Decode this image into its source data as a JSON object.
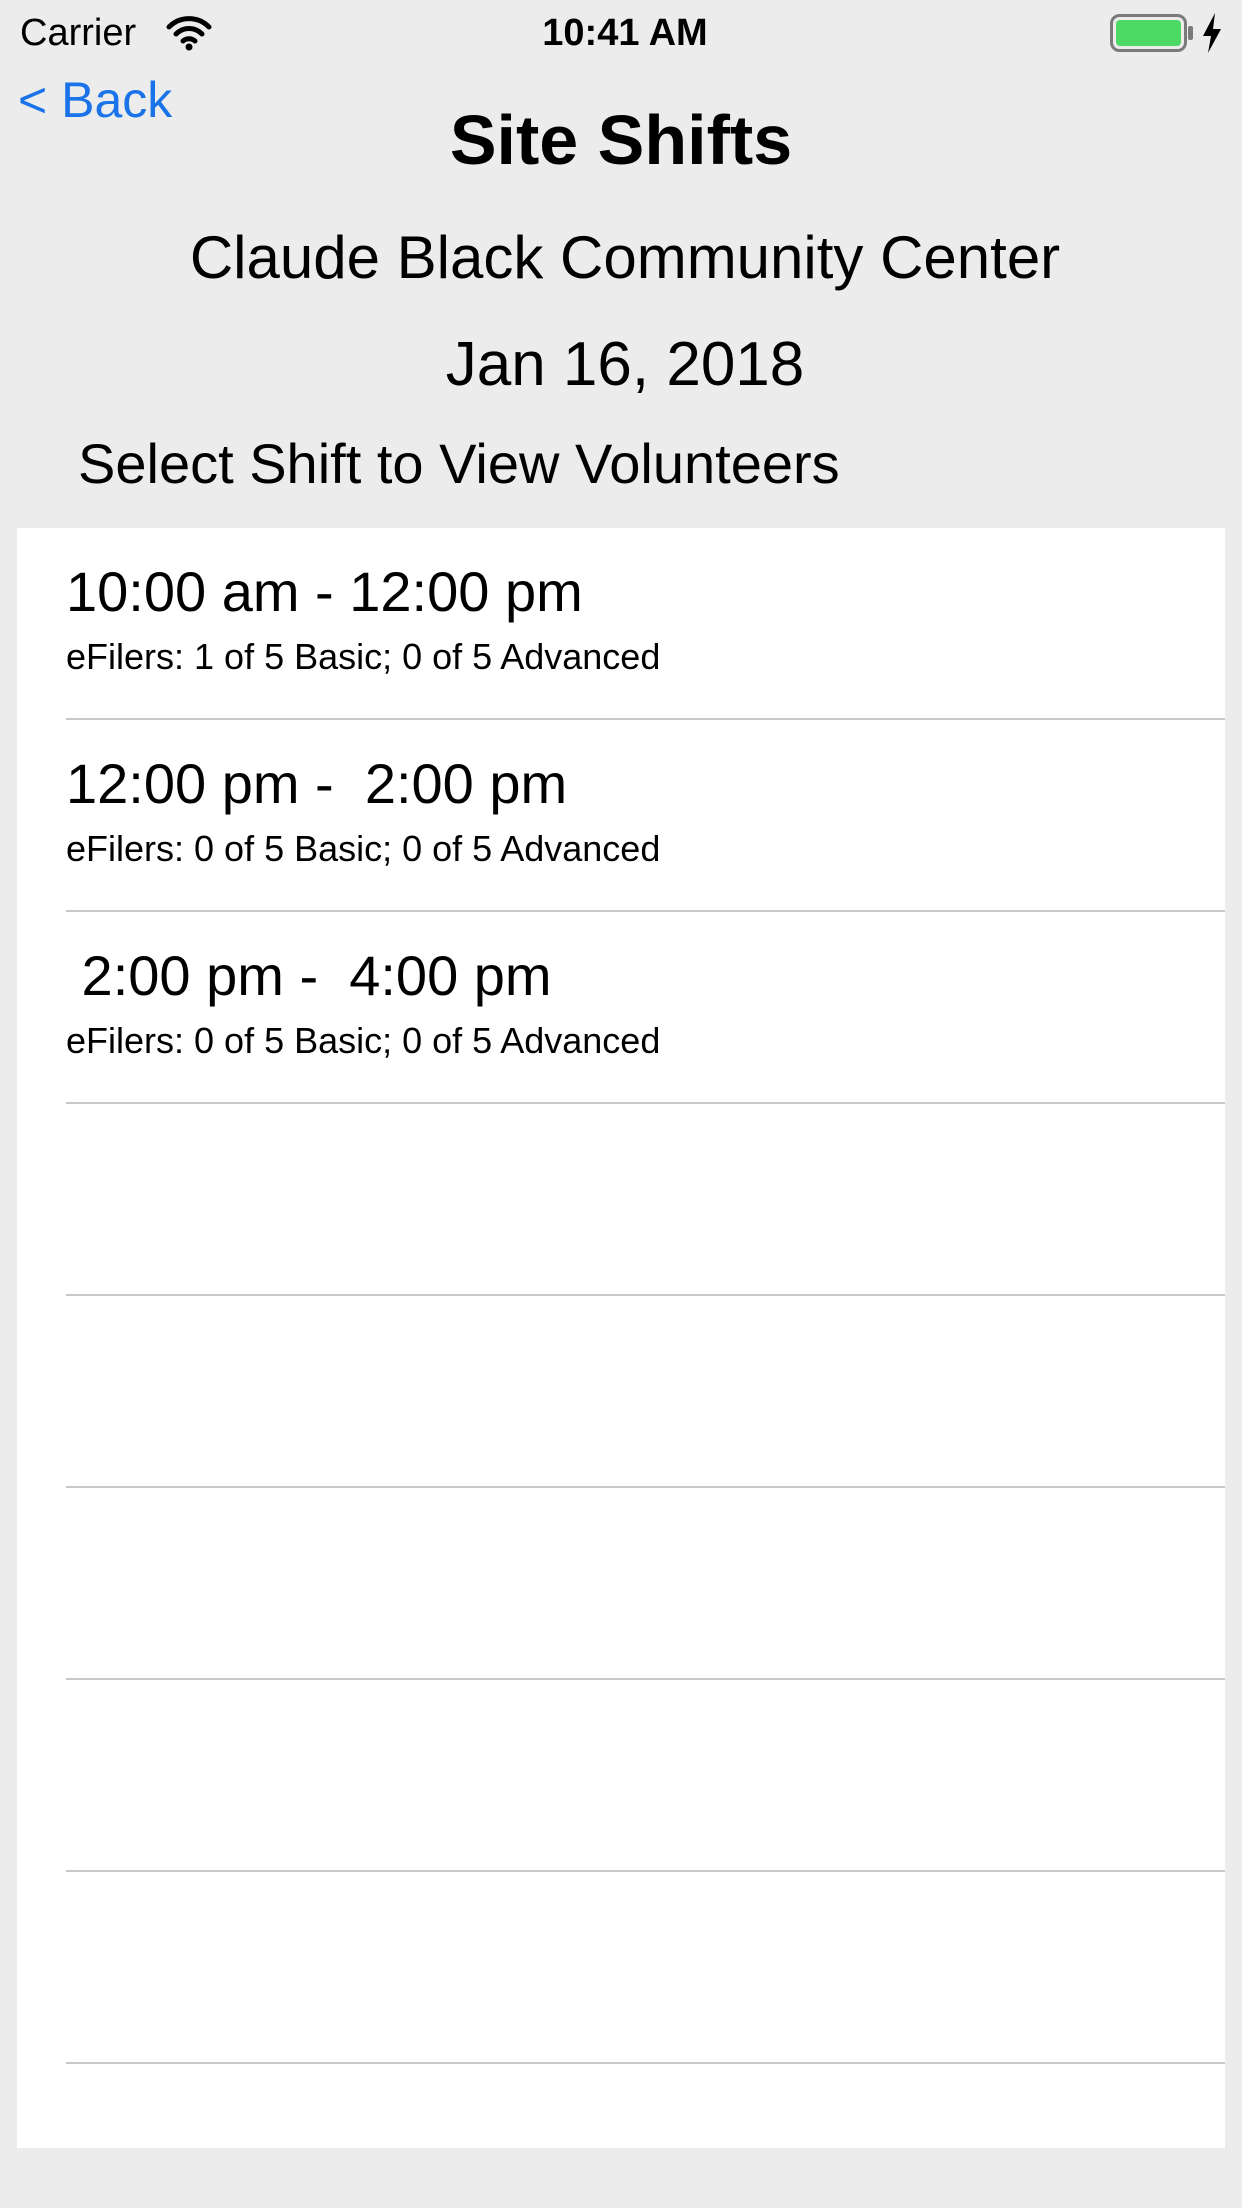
{
  "status_bar": {
    "carrier": "Carrier",
    "time": "10:41 AM",
    "icons": [
      "wifi-icon",
      "battery-icon",
      "charging-bolt-icon"
    ],
    "battery_color": "#4cd964"
  },
  "nav": {
    "back_label": "< Back",
    "title": "Site Shifts",
    "back_color": "#1a73e8"
  },
  "site": {
    "name": "Claude Black Community Center",
    "date": "Jan 16, 2018"
  },
  "instruction": "Select Shift to View Volunteers",
  "shifts": [
    {
      "time": "10:00 am - 12:00 pm",
      "efilers": "eFilers: 1 of 5 Basic; 0 of 5 Advanced"
    },
    {
      "time": "12:00 pm -  2:00 pm",
      "efilers": "eFilers: 0 of 5 Basic; 0 of 5 Advanced"
    },
    {
      "time": " 2:00 pm -  4:00 pm",
      "efilers": "eFilers: 0 of 5 Basic; 0 of 5 Advanced"
    }
  ]
}
